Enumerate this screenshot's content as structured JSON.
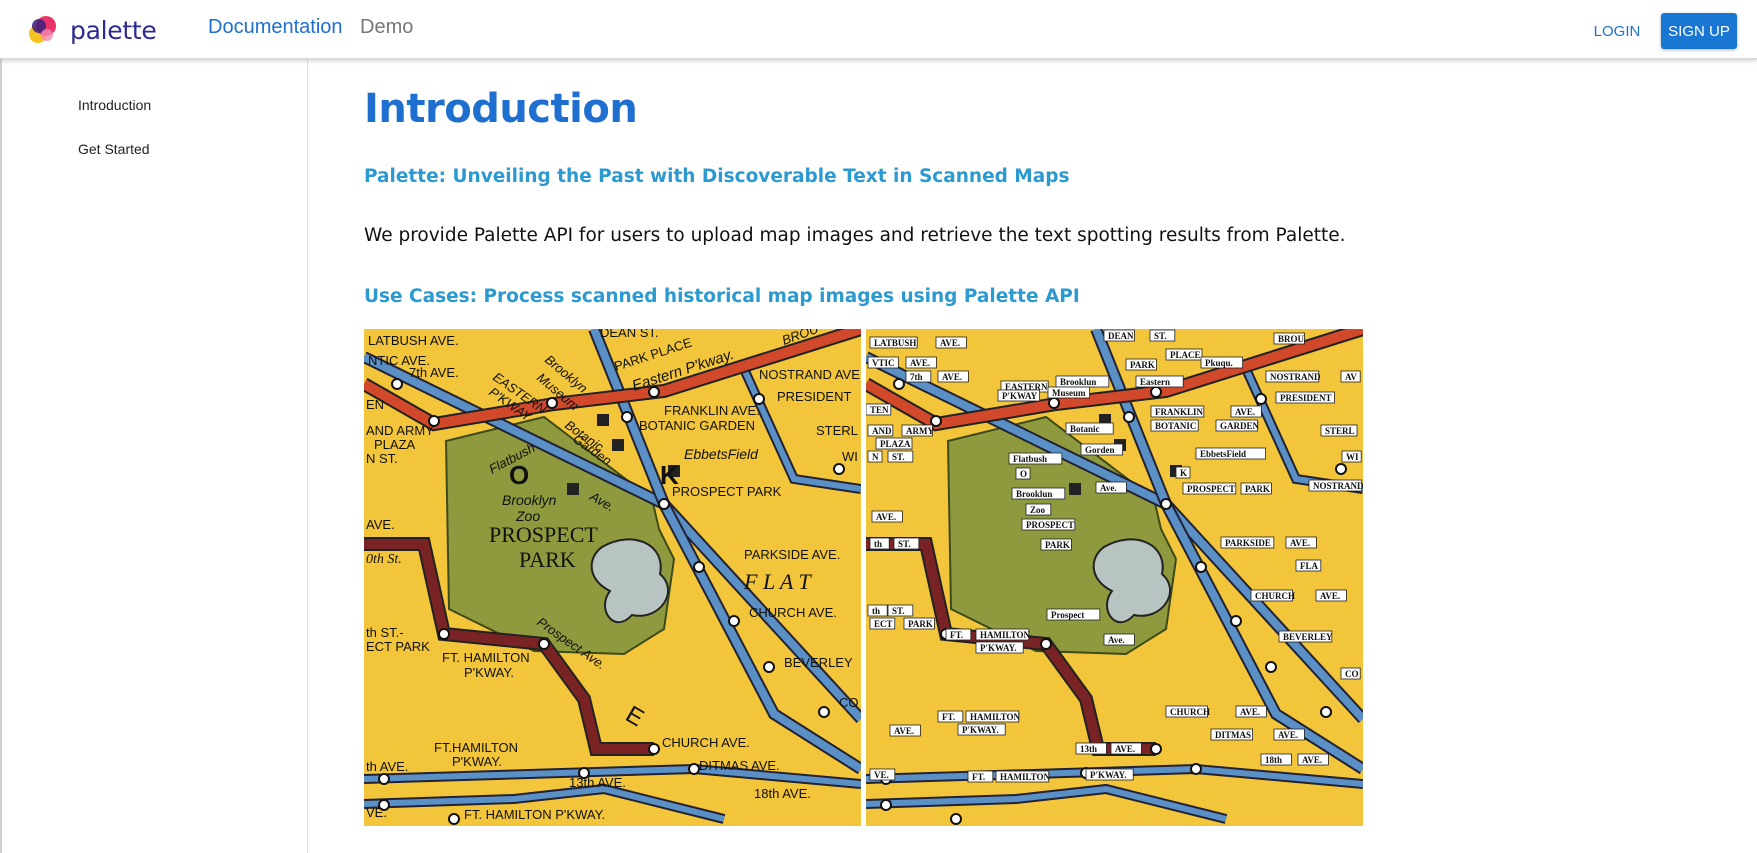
{
  "header": {
    "brand": "palette",
    "nav": {
      "documentation": "Documentation",
      "demo": "Demo"
    },
    "login": "LOGIN",
    "signup": "SIGN UP",
    "accent_color": "#1e6fd0",
    "brand_color": "#2c2a8e"
  },
  "sidebar": {
    "items": [
      {
        "label": "Introduction"
      },
      {
        "label": "Get Started"
      }
    ]
  },
  "main": {
    "title": "Introduction",
    "subtitle": "Palette: Unveiling the Past with Discoverable Text in Scanned Maps",
    "description": "We provide Palette API for users to upload map images and retrieve the text spotting results from Palette.",
    "use_cases_heading": "Use Cases: Process scanned historical map images using Palette API"
  },
  "maps": {
    "original_labels": {
      "latbush": "LATBUSH AVE.",
      "dean": "DEAN ST.",
      "ntic": "NTIC AVE.",
      "seventh": "7th AVE.",
      "park_place": "PARK PLACE",
      "eastern_pkway": "Eastern P'kway.",
      "brou": "BROU",
      "nostrand": "NOSTRAND AVE.",
      "president": "PRESIDENT",
      "eastern": "EASTERN",
      "pkway": "P'KWAY",
      "brooklyn": "Brooklyn",
      "museum": "Museum",
      "franklin": "FRANKLIN AVE.",
      "botanic_garden": "BOTANIC GARDEN",
      "botanic": "Botanic",
      "garden": "Garden",
      "en": "EN",
      "and_army": "AND ARMY",
      "plaza": "PLAZA",
      "n_st": "N ST.",
      "sterl": "STERL",
      "ebbets": "EbbetsField",
      "wi": "WI",
      "flatbush": "Flatbush",
      "o": "O",
      "k": "K",
      "ave": "Ave.",
      "prospect_park_small": "PROSPECT PARK",
      "brooklyn2": "Brooklyn",
      "zoo": "Zoo",
      "prospect": "PROSPECT",
      "park": "PARK",
      "w_ave": "AVE.",
      "parkside": "PARKSIDE AVE.",
      "flat": "F L A T",
      "oth_st": "0th St.",
      "church": "CHURCH AVE.",
      "th_st": "th ST.-",
      "ect_park": "ECT PARK",
      "prospect_ave": "Prospect Ave.",
      "ft_hamilton": "FT. HAMILTON",
      "pkway2": "P'KWAY.",
      "beverley": "BEVERLEY",
      "co": "CO",
      "e": "E",
      "church2": "CHURCH AVE.",
      "ft_hamilton2": "FT.HAMILTON",
      "pkway3": "P'KWAY.",
      "th_ave": "th AVE.",
      "ditmas": "DITMAS AVE.",
      "thirteenth": "13th AVE.",
      "eighteenth": "18th AVE.",
      "ve": "VE.",
      "ft_hamilton3": "FT. HAMILTON  P'KWAY."
    },
    "detected_labels": {
      "l_latbush": "LATBUSH",
      "l_ave1": "AVE.",
      "l_dean": "DEAN",
      "l_st1": "ST.",
      "l_brou": "BROU",
      "l_vtic": "VTIC",
      "l_ave2": "AVE.",
      "l_park": "PARK",
      "l_place": "PLACE",
      "l_pkuqu": "Pkuqu.",
      "l_7th": "7th",
      "l_ave3": "AVE.",
      "l_brooklun": "Brooklun",
      "l_eastern1": "EASTERN",
      "l_eastern2": "Eastern",
      "l_pkway": "P'KWAY",
      "l_museum": "Museum",
      "l_nostrand": "NOSTRAND",
      "l_av": "AV",
      "l_president": "PRESIDENT",
      "l_ten": "TEN",
      "l_franklin": "FRANKLIN",
      "l_ave4": "AVE.",
      "l_botanic_up": "BOTANIC",
      "l_garden_up": "GARDEN",
      "l_and": "AND",
      "l_army": "ARMY",
      "l_botanic": "Botanic",
      "l_sterl": "STERL",
      "l_plaza": "PLAZA",
      "l_gorden": "Gorden",
      "l_n": "N",
      "l_st2": "ST.",
      "l_ebbetsfield": "EbbetsField",
      "l_wi": "WI",
      "l_flatbush": "Flatbush",
      "l_o": "O",
      "l_k": "K",
      "l_ave5": "Ave.",
      "l_prospect1": "PROSPECT",
      "l_park2": "PARK",
      "l_nostrand2": "NOSTRAND",
      "l_brooklun2": "Brooklun",
      "l_zoo": "Zoo",
      "l_ave6": "AVE.",
      "l_prospect2": "PROSPECT",
      "l_park3": "PARK",
      "l_parkside": "PARKSIDE",
      "l_ave7": "AVE.",
      "l_th": "th",
      "l_st3": "ST.",
      "l_fla": "FLA",
      "l_church": "CHURCH",
      "l_ave8": "AVE.",
      "l_th2": "th",
      "l_st4": "ST.",
      "l_ect": "ECT",
      "l_park4": "PARK",
      "l_prospect3": "Prospect",
      "l_ft": "FT.",
      "l_hamilton": "HAMILTON",
      "l_pkway2": "P'KWAY.",
      "l_ave9": "Ave.",
      "l_beverley": "BEVERLEY",
      "l_co": "CO",
      "l_church2": "CHURCH",
      "l_ave10": "AVE.",
      "l_ft2": "FT.",
      "l_hamilton2": "HAMILTON",
      "l_pkway3": "P'KWAY.",
      "l_ave11": "AVE.",
      "l_ditmas": "DITMAS",
      "l_ave12": "AVE.",
      "l_13th": "13th",
      "l_ave13": "AVE.",
      "l_18th": "18th",
      "l_ave14": "AVE.",
      "l_ve": "VE.",
      "l_ft3": "FT.",
      "l_hamilton3": "HAMILTON",
      "l_pkway4": "P'KWAY."
    }
  }
}
